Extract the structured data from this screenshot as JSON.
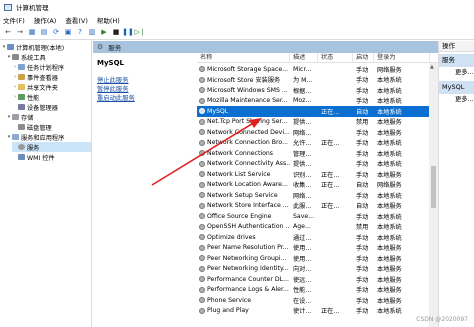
{
  "window": {
    "title": "计算机管理"
  },
  "menu": [
    "文件(F)",
    "操作(A)",
    "查看(V)",
    "帮助(H)"
  ],
  "tree": {
    "root": "计算机管理(本地)",
    "system_tools": "系统工具",
    "task_scheduler": "任务计划程序",
    "event_viewer": "事件查看器",
    "shared_folders": "共享文件夹",
    "performance": "性能",
    "device_manager": "设备管理器",
    "storage": "存储",
    "disk_management": "磁盘管理",
    "services_apps": "服务和应用程序",
    "services": "服务",
    "wmi": "WMI 控件"
  },
  "header": {
    "title": "服务"
  },
  "detail": {
    "service_name": "MySQL",
    "stop_link": "停止此服务",
    "pause_link": "暂停此服务",
    "restart_link": "重启动此服务"
  },
  "columns": [
    "名称",
    "描述",
    "状态",
    "启动",
    "登录为"
  ],
  "services": [
    {
      "name": "Microsoft Storage Space...",
      "desc": "Micr...",
      "status": "",
      "startup": "手动",
      "logon": "网络服务"
    },
    {
      "name": "Microsoft Store 安装服务",
      "desc": "为 M...",
      "status": "",
      "startup": "手动",
      "logon": "本地系统"
    },
    {
      "name": "Microsoft Windows SMS ...",
      "desc": "根据...",
      "status": "",
      "startup": "手动",
      "logon": "本地系统"
    },
    {
      "name": "Mozilla Maintenance Ser...",
      "desc": "Moz...",
      "status": "",
      "startup": "手动",
      "logon": "本地系统"
    },
    {
      "name": "MySQL",
      "desc": "",
      "status": "正在...",
      "startup": "自动",
      "logon": "本地系统"
    },
    {
      "name": "Net.Tcp Port Sharing Ser...",
      "desc": "提供...",
      "status": "",
      "startup": "禁用",
      "logon": "本地服务"
    },
    {
      "name": "Network Connected Devi...",
      "desc": "网络...",
      "status": "",
      "startup": "手动",
      "logon": "本地服务"
    },
    {
      "name": "Network Connection Bro...",
      "desc": "允许...",
      "status": "正在...",
      "startup": "手动",
      "logon": "本地系统"
    },
    {
      "name": "Network Connections",
      "desc": "管理...",
      "status": "",
      "startup": "手动",
      "logon": "本地系统"
    },
    {
      "name": "Network Connectivity Ass...",
      "desc": "提供...",
      "status": "",
      "startup": "手动",
      "logon": "本地系统"
    },
    {
      "name": "Network List Service",
      "desc": "识别...",
      "status": "正在...",
      "startup": "手动",
      "logon": "本地服务"
    },
    {
      "name": "Network Location Aware...",
      "desc": "收集...",
      "status": "正在...",
      "startup": "自动",
      "logon": "网络服务"
    },
    {
      "name": "Network Setup Service",
      "desc": "网络...",
      "status": "",
      "startup": "手动",
      "logon": "本地系统"
    },
    {
      "name": "Network Store Interface ...",
      "desc": "此服...",
      "status": "正在...",
      "startup": "自动",
      "logon": "本地服务"
    },
    {
      "name": "Office  Source Engine",
      "desc": "Save...",
      "status": "",
      "startup": "手动",
      "logon": "本地系统"
    },
    {
      "name": "OpenSSH Authentication ...",
      "desc": "Age...",
      "status": "",
      "startup": "禁用",
      "logon": "本地系统"
    },
    {
      "name": "Optimize drives",
      "desc": "通过...",
      "status": "",
      "startup": "手动",
      "logon": "本地系统"
    },
    {
      "name": "Peer Name Resolution Pr...",
      "desc": "使用...",
      "status": "",
      "startup": "手动",
      "logon": "本地服务"
    },
    {
      "name": "Peer Networking Groupi...",
      "desc": "使用...",
      "status": "",
      "startup": "手动",
      "logon": "本地服务"
    },
    {
      "name": "Peer Networking Identity...",
      "desc": "向对...",
      "status": "",
      "startup": "手动",
      "logon": "本地服务"
    },
    {
      "name": "Performance Counter DL...",
      "desc": "使远...",
      "status": "",
      "startup": "手动",
      "logon": "本地服务"
    },
    {
      "name": "Performance Logs & Aler...",
      "desc": "性能...",
      "status": "",
      "startup": "手动",
      "logon": "本地服务"
    },
    {
      "name": "Phone Service",
      "desc": "在设...",
      "status": "",
      "startup": "手动",
      "logon": "本地服务"
    },
    {
      "name": "Plug and Play",
      "desc": "使计...",
      "status": "正在...",
      "startup": "手动",
      "logon": "本地系统"
    }
  ],
  "actions": {
    "title": "操作",
    "section1": "服务",
    "more1": "更多...",
    "section2": "MySQL",
    "more2": "更多..."
  },
  "watermark": "CSDN @2020097"
}
